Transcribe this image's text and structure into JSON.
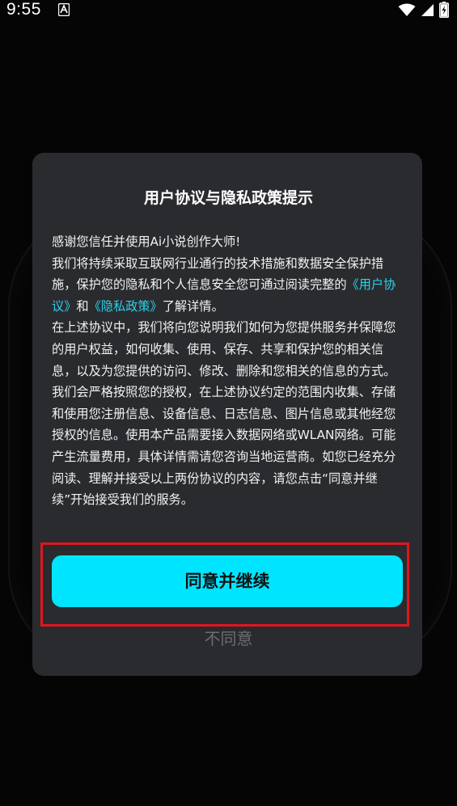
{
  "status_bar": {
    "time": "9:55"
  },
  "dialog": {
    "title": "用户协议与隐私政策提示",
    "body": {
      "line1": "感谢您信任并使用Ai小说创作大师!",
      "para2_text": "我们将持续采取互联网行业通行的技术措施和数据安全保护措施，保护您的隐私和个人信息安全您可通过阅读完整的",
      "user_agreement_link": "《用户协议》",
      "and": "和",
      "privacy_policy_link": "《隐私政策》",
      "para2_end": "了解详情。",
      "para3": "在上述协议中，我们将向您说明我们如何为您提供服务并保障您的用户权益，如何收集、使用、保存、共享和保护您的相关信息，以及为您提供的访问、修改、删除和您相关的信息的方式。我们会严格按照您的授权，在上述协议约定的范围内收集、存储和使用您注册信息、设备信息、日志信息、图片信息或其他经您授权的信息。使用本产品需要接入数据网络或WLAN网络。可能产生流量费用，具体详情需请您咨询当地运营商。如您已经充分阅读、理解并接受以上两份协议的内容，请您点击“同意并继续”开始接受我们的服务。"
    },
    "agree_label": "同意并继续",
    "disagree_label": "不同意"
  },
  "colors": {
    "accent": "#00e5ff",
    "link": "#29d3ee",
    "highlight_border": "#e0161f",
    "dialog_bg": "#2a2b2e"
  }
}
